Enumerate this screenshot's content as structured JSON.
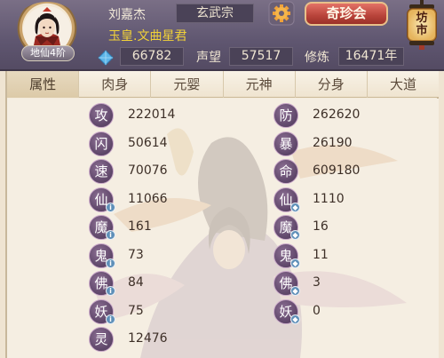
{
  "player": {
    "name": "刘嘉杰",
    "sect": "玄武宗",
    "titles": "玉皇.文曲星君",
    "rank": "地仙4阶",
    "gems": "66782",
    "reputation_label": "声望",
    "reputation": "57517",
    "cultivation_label": "修炼",
    "cultivation": "16471年"
  },
  "buttons": {
    "treasure": "奇珍会",
    "market": "坊市"
  },
  "tabs": [
    {
      "label": "属性",
      "active": true
    },
    {
      "label": "肉身",
      "active": false
    },
    {
      "label": "元婴",
      "active": false
    },
    {
      "label": "元神",
      "active": false
    },
    {
      "label": "分身",
      "active": false
    },
    {
      "label": "大道",
      "active": false
    }
  ],
  "left_stats": [
    {
      "char": "攻",
      "value": "222014",
      "dot": ""
    },
    {
      "char": "闪",
      "value": "50614",
      "dot": ""
    },
    {
      "char": "速",
      "value": "70076",
      "dot": ""
    },
    {
      "char": "仙",
      "value": "11066",
      "dot": "i"
    },
    {
      "char": "魔",
      "value": "161",
      "dot": "i"
    },
    {
      "char": "鬼",
      "value": "73",
      "dot": "i"
    },
    {
      "char": "佛",
      "value": "84",
      "dot": "i"
    },
    {
      "char": "妖",
      "value": "75",
      "dot": "i"
    },
    {
      "char": "灵",
      "value": "12476",
      "dot": ""
    }
  ],
  "right_stats": [
    {
      "char": "防",
      "value": "262620",
      "dot": ""
    },
    {
      "char": "暴",
      "value": "26190",
      "dot": ""
    },
    {
      "char": "命",
      "value": "609180",
      "dot": ""
    },
    {
      "char": "仙",
      "value": "1110",
      "dot": "◆"
    },
    {
      "char": "魔",
      "value": "16",
      "dot": "◆"
    },
    {
      "char": "鬼",
      "value": "11",
      "dot": "◆"
    },
    {
      "char": "佛",
      "value": "3",
      "dot": "◆"
    },
    {
      "char": "妖",
      "value": "0",
      "dot": "◆"
    }
  ],
  "icons": {
    "gear": "gear-icon",
    "gem": "gem-icon",
    "avatar": "avatar"
  },
  "colors": {
    "header_bg": "#5f5670",
    "title_yellow": "#f2d238",
    "badge_purple": "#5d4568",
    "dot_blue": "#5e8fb8",
    "treasure_red": "#b8433a"
  }
}
